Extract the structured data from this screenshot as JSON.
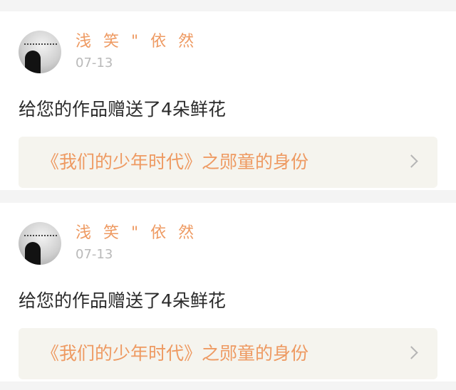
{
  "feed": {
    "items": [
      {
        "username": "浅 笑 \" 依 然",
        "date": "07-13",
        "message": "给您的作品赠送了4朵鲜花",
        "work_title": "《我们的少年时代》之郧童的身份",
        "avatar_icon": "avatar-silhouette-moon",
        "chevron_icon": "chevron-right-icon"
      },
      {
        "username": "浅 笑 \" 依 然",
        "date": "07-13",
        "message": "给您的作品赠送了4朵鲜花",
        "work_title": "《我们的少年时代》之郧童的身份",
        "avatar_icon": "avatar-silhouette-moon",
        "chevron_icon": "chevron-right-icon"
      }
    ]
  },
  "colors": {
    "accent": "#ee9a62",
    "date_text": "#b9b9b9",
    "message_text": "#2b2b2b",
    "link_background": "#f5f4ee",
    "page_background": "#f4f4f4"
  }
}
